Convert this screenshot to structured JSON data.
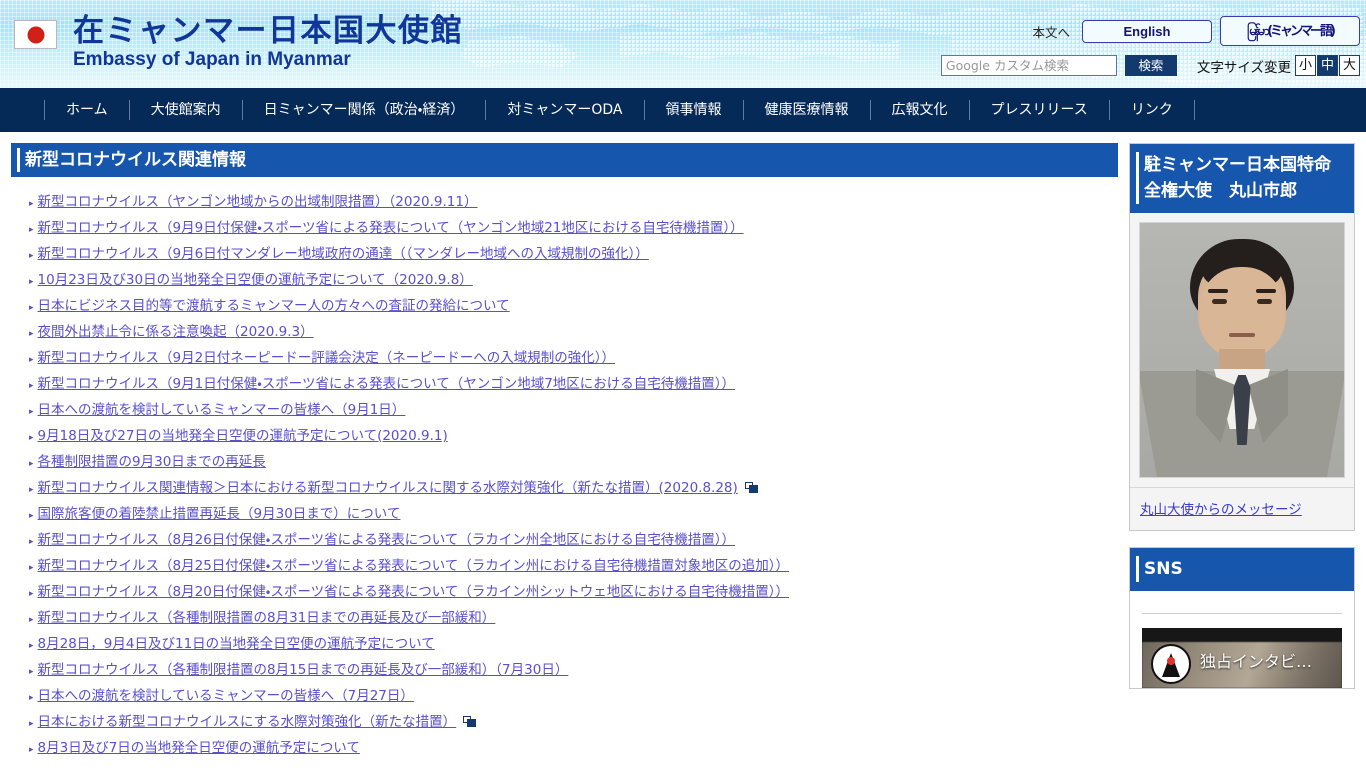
{
  "header": {
    "flag_icon": "japan-flag-icon",
    "title_jp": "在ミャンマー日本国大使館",
    "title_en": "Embassy of Japan in Myanmar",
    "skip_link": "本文へ",
    "lang_english": "English",
    "lang_myanmar": "မြန်မာ(ミャンマー語)",
    "search_placeholder": "Google カスタム検索",
    "search_value": "",
    "search_button": "検索",
    "fontsize_label": "文字サイズ変更",
    "fontsize_small": "小",
    "fontsize_medium": "中",
    "fontsize_large": "大",
    "fontsize_active": "中"
  },
  "nav": {
    "items": [
      {
        "label": "ホーム"
      },
      {
        "label": "大使館案内"
      },
      {
        "label": "日ミャンマー関係（政治・経済）"
      },
      {
        "label": "対ミャンマーODA"
      },
      {
        "label": "領事情報"
      },
      {
        "label": "健康医療情報"
      },
      {
        "label": "広報文化"
      },
      {
        "label": "プレスリリース"
      },
      {
        "label": "リンク"
      }
    ]
  },
  "main": {
    "section_title": "新型コロナウイルス関連情報",
    "links": [
      {
        "text": "新型コロナウイルス（ヤンゴン地域からの出域制限措置）（2020.9.11）",
        "external": false
      },
      {
        "text": "新型コロナウイルス（9月9日付保健・スポーツ省による発表について（ヤンゴン地域21地区における自宅待機措置））",
        "external": false
      },
      {
        "text": "新型コロナウイルス（9月6日付マンダレー地域政府の通達（（マンダレー地域への入域規制の強化））",
        "external": false
      },
      {
        "text": "10月23日及び30日の当地発全日空便の運航予定について（2020.9.8）",
        "external": false
      },
      {
        "text": "日本にビジネス目的等で渡航するミャンマー人の方々への査証の発給について",
        "external": false
      },
      {
        "text": "夜間外出禁止令に係る注意喚起（2020.9.3）",
        "external": false
      },
      {
        "text": "新型コロナウイルス（9月2日付ネーピードー評議会決定（ネーピードーへの入域規制の強化））",
        "external": false
      },
      {
        "text": "新型コロナウイルス（9月1日付保健・スポーツ省による発表について（ヤンゴン地域7地区における自宅待機措置））",
        "external": false
      },
      {
        "text": "日本への渡航を検討しているミャンマーの皆様へ（9月1日）",
        "external": false
      },
      {
        "text": "9月18日及び27日の当地発全日空便の運航予定について(2020.9.1)",
        "external": false
      },
      {
        "text": "各種制限措置の9月30日までの再延長",
        "external": false
      },
      {
        "text": "新型コロナウイルス関連情報＞日本における新型コロナウイルスに関する水際対策強化（新たな措置）(2020.8.28)",
        "external": true
      },
      {
        "text": "国際旅客便の着陸禁止措置再延長（9月30日まで）について",
        "external": false
      },
      {
        "text": "新型コロナウイルス（8月26日付保健・スポーツ省による発表について（ラカイン州全地区における自宅待機措置））",
        "external": false
      },
      {
        "text": "新型コロナウイルス（8月25日付保健・スポーツ省による発表について（ラカイン州における自宅待機措置対象地区の追加））",
        "external": false
      },
      {
        "text": "新型コロナウイルス（8月20日付保健・スポーツ省による発表について（ラカイン州シットウェ地区における自宅待機措置））",
        "external": false
      },
      {
        "text": "新型コロナウイルス（各種制限措置の8月31日までの再延長及び一部緩和）",
        "external": false
      },
      {
        "text": "8月28日，9月4日及び11日の当地発全日空便の運航予定について",
        "external": false
      },
      {
        "text": "新型コロナウイルス（各種制限措置の8月15日までの再延長及び一部緩和）（7月30日）",
        "external": false
      },
      {
        "text": "日本への渡航を検討しているミャンマーの皆様へ（7月27日）",
        "external": false
      },
      {
        "text": "日本における新型コロナウイルスにする水際対策強化（新たな措置）",
        "external": true
      },
      {
        "text": "8月3日及び7日の当地発全日空便の運航予定について",
        "external": false
      }
    ]
  },
  "sidebar": {
    "ambassador": {
      "heading": "駐ミャンマー日本国特命全権大使　丸山市郎",
      "photo_alt": "ambassador-portrait",
      "message_link": "丸山大使からのメッセージ"
    },
    "sns": {
      "heading": "SNS",
      "thumb_caption": "独占インタビ…",
      "thumb_logo": "embassy-logo-icon"
    }
  },
  "colors": {
    "nav_bg": "#062a57",
    "accent_blue": "#1656ad",
    "link_purple": "#5a4fcf",
    "header_gradient_top": "#bfe8f7",
    "header_gradient_bottom": "#e8f8fd"
  }
}
